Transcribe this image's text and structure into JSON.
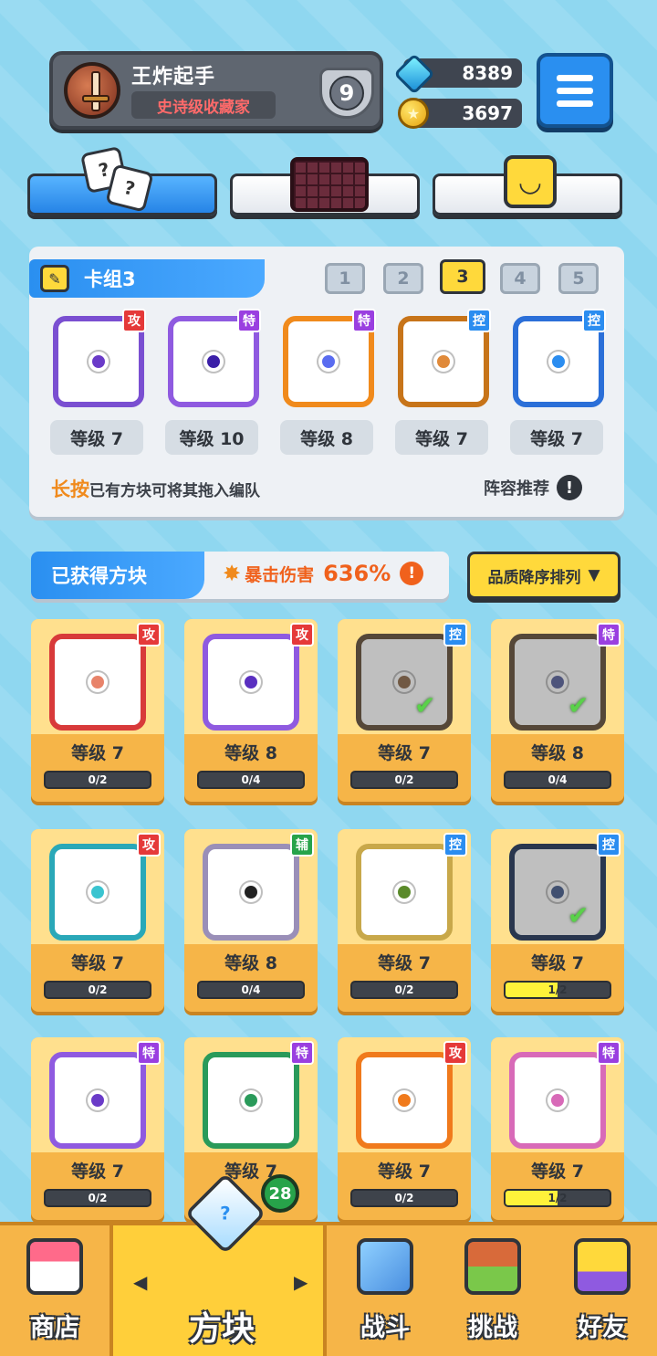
{
  "profile": {
    "name": "王炸起手",
    "title": "史诗级收藏家",
    "rank": "9"
  },
  "currency": {
    "gems": "8389",
    "coins": "3697"
  },
  "category_tabs": [
    {
      "name": "dice",
      "active": true
    },
    {
      "name": "board",
      "active": false
    },
    {
      "name": "emote",
      "active": false
    }
  ],
  "deck": {
    "title": "卡组3",
    "numbers": [
      "1",
      "2",
      "3",
      "4",
      "5"
    ],
    "active_index": 2,
    "slots": [
      {
        "tag": "攻",
        "tag_type": "atk",
        "color": "#7a4fd1",
        "core": "#6a3bc8",
        "level": "等级 7"
      },
      {
        "tag": "特",
        "tag_type": "spe",
        "color": "#8f5ae0",
        "core": "#3b1fa8",
        "level": "等级 10"
      },
      {
        "tag": "特",
        "tag_type": "spe",
        "color": "#f08a1c",
        "core": "#5a6cf0",
        "level": "等级 8"
      },
      {
        "tag": "控",
        "tag_type": "ctl",
        "color": "#c77419",
        "core": "#e08a3a",
        "level": "等级 7"
      },
      {
        "tag": "控",
        "tag_type": "ctl",
        "color": "#2b6fd8",
        "core": "#2b8df0",
        "level": "等级 7"
      }
    ],
    "hint_bold": "长按",
    "hint_rest": "已有方块可将其拖入编队",
    "recommend": "阵容推荐"
  },
  "owned": {
    "title": "已获得方块",
    "crit_label": "暴击伤害",
    "crit_value": "636%",
    "sort_label": "品质降序排列",
    "cards": [
      {
        "tag": "攻",
        "tag_type": "atk",
        "color": "#d83a3a",
        "core": "#e8836a",
        "level": "等级 7",
        "progress": "0/2",
        "fill": 0,
        "check": false,
        "dim": false
      },
      {
        "tag": "攻",
        "tag_type": "atk",
        "color": "#8f5ae0",
        "core": "#5a2fc0",
        "level": "等级 8",
        "progress": "0/4",
        "fill": 0,
        "check": false,
        "dim": false
      },
      {
        "tag": "控",
        "tag_type": "ctl",
        "color": "#8a5a2a",
        "core": "#c0702a",
        "level": "等级 7",
        "progress": "0/2",
        "fill": 0,
        "check": true,
        "dim": true
      },
      {
        "tag": "特",
        "tag_type": "spe",
        "color": "#8a5a2a",
        "core": "#5a6cf0",
        "level": "等级 8",
        "progress": "0/4",
        "fill": 0,
        "check": true,
        "dim": true
      },
      {
        "tag": "攻",
        "tag_type": "atk",
        "color": "#2aa8b8",
        "core": "#3ac4d0",
        "level": "等级 7",
        "progress": "0/2",
        "fill": 0,
        "check": false,
        "dim": false
      },
      {
        "tag": "辅",
        "tag_type": "sup",
        "color": "#9a8fb8",
        "core": "#222222",
        "level": "等级 8",
        "progress": "0/4",
        "fill": 0,
        "check": false,
        "dim": false
      },
      {
        "tag": "控",
        "tag_type": "ctl",
        "color": "#c8a84a",
        "core": "#5a8a2a",
        "level": "等级 7",
        "progress": "0/2",
        "fill": 0,
        "check": false,
        "dim": false
      },
      {
        "tag": "控",
        "tag_type": "ctl",
        "color": "#1e4a9a",
        "core": "#3a6cd8",
        "level": "等级 7",
        "progress": "1/2",
        "fill": 0.5,
        "check": true,
        "dim": true
      },
      {
        "tag": "特",
        "tag_type": "spe",
        "color": "#8f5ae0",
        "core": "#6a3bc8",
        "level": "等级 7",
        "progress": "0/2",
        "fill": 0,
        "check": false,
        "dim": false
      },
      {
        "tag": "特",
        "tag_type": "spe",
        "color": "#2a9a5a",
        "core": "#2a9a5a",
        "level": "等级 7",
        "progress": "",
        "fill": 0,
        "check": false,
        "dim": false
      },
      {
        "tag": "攻",
        "tag_type": "atk",
        "color": "#f07a1c",
        "core": "#f07a1c",
        "level": "等级 7",
        "progress": "0/2",
        "fill": 0,
        "check": false,
        "dim": false
      },
      {
        "tag": "特",
        "tag_type": "spe",
        "color": "#d86ab8",
        "core": "#d86ab8",
        "level": "等级 7",
        "progress": "1/2",
        "fill": 0.5,
        "check": false,
        "dim": false
      }
    ]
  },
  "nav": {
    "shop": "商店",
    "blocks": "方块",
    "blocks_badge": "28",
    "battle": "战斗",
    "challenge": "挑战",
    "friends": "好友"
  },
  "colors": {
    "accent_blue": "#2a8ff0",
    "accent_yellow": "#ffd93b",
    "card_orange": "#f6b548"
  }
}
